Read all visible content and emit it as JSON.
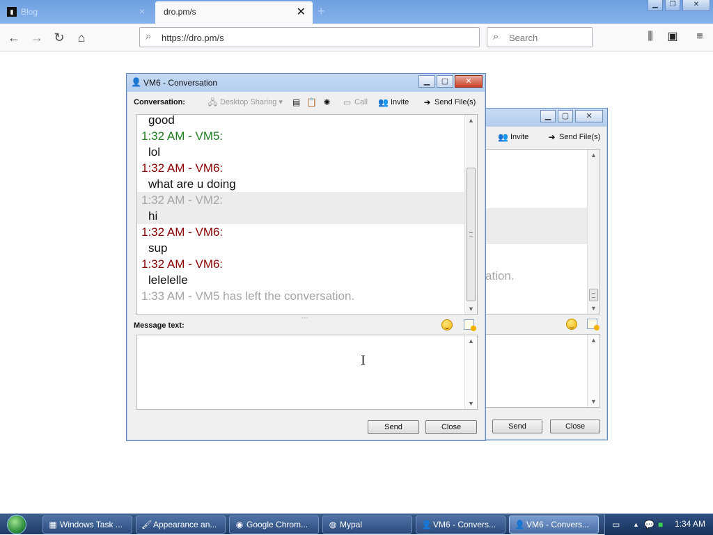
{
  "browser": {
    "inactive_tab_title": "Blog",
    "active_tab_title": "dro.pm/s",
    "url": "https://dro.pm/s",
    "search_placeholder": "Search",
    "icons": [
      "back-arrow-icon",
      "forward-arrow-icon",
      "reload-icon",
      "home-icon",
      "library-icon",
      "sidebar-icon",
      "menu-icon"
    ]
  },
  "back_window": {
    "toolbar": {
      "invite": "Invite",
      "send_files": "Send File(s)"
    },
    "partial_text": "ation.",
    "send": "Send",
    "close": "Close"
  },
  "conversation_window": {
    "title": "VM6 - Conversation",
    "toolbar": {
      "label": "Conversation:",
      "desktop_sharing": "Desktop Sharing",
      "call": "Call",
      "invite": "Invite",
      "send_files": "Send File(s)"
    },
    "messages": [
      {
        "text": "good",
        "kind": "body"
      },
      {
        "text": "1:32 AM - VM5:",
        "kind": "hdr",
        "color": "#1e7d1e"
      },
      {
        "text": "lol",
        "kind": "body"
      },
      {
        "text": "1:32 AM - VM6:",
        "kind": "hdr",
        "color": "#8b0000"
      },
      {
        "text": "what are u doing",
        "kind": "body"
      },
      {
        "text": "1:32 AM - VM2:",
        "kind": "hdr",
        "color": "#a5a5a5"
      },
      {
        "text": "hi",
        "kind": "body"
      },
      {
        "text": "1:32 AM - VM6:",
        "kind": "hdr",
        "color": "#8b0000"
      },
      {
        "text": "sup",
        "kind": "body"
      },
      {
        "text": "1:32 AM - VM6:",
        "kind": "hdr",
        "color": "#8b0000"
      },
      {
        "text": "lelelelle",
        "kind": "body"
      },
      {
        "text": "1:33 AM - VM5 has left the conversation.",
        "kind": "hdr",
        "color": "#a5a5a5"
      }
    ],
    "message_label": "Message text:",
    "message_value": "",
    "send": "Send",
    "close": "Close"
  },
  "taskbar": {
    "buttons": [
      {
        "label": "Windows Task ..."
      },
      {
        "label": "Appearance an..."
      },
      {
        "label": "Google Chrom..."
      },
      {
        "label": "Mypal"
      },
      {
        "label": "VM6 - Convers..."
      },
      {
        "label": "VM6 - Convers..."
      }
    ],
    "clock": "1:34 AM"
  }
}
